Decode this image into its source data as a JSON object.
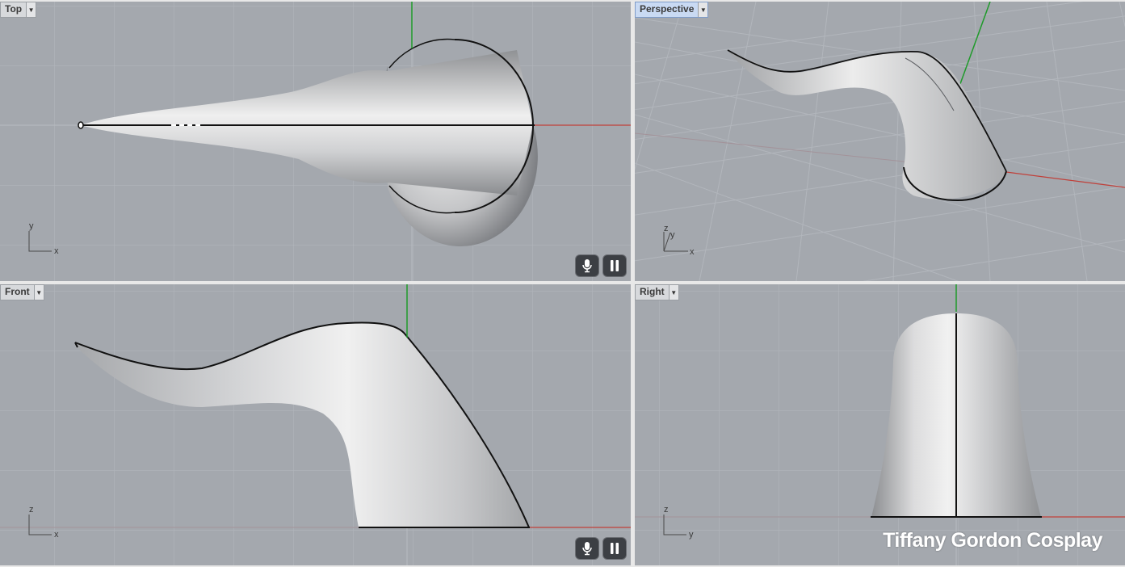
{
  "viewports": {
    "top": {
      "label": "Top",
      "axis_a": "y",
      "axis_b": "x"
    },
    "perspective": {
      "label": "Perspective",
      "axis_a": "z",
      "axis_b": "y",
      "axis_c": "x"
    },
    "front": {
      "label": "Front",
      "axis_a": "z",
      "axis_b": "x"
    },
    "right": {
      "label": "Right",
      "axis_a": "z",
      "axis_b": "y"
    }
  },
  "icons": {
    "dropdown": "triangle-down-icon",
    "microphone": "microphone-icon",
    "pause": "pause-icon"
  },
  "colors": {
    "viewport_bg": "#a4a8ae",
    "grid": "#b4b8be",
    "x_axis": "#c0403a",
    "y_axis": "#1f9a2a",
    "surface": "#c8c9cb",
    "outline": "#111111"
  },
  "watermark": "Tiffany Gordon Cosplay"
}
